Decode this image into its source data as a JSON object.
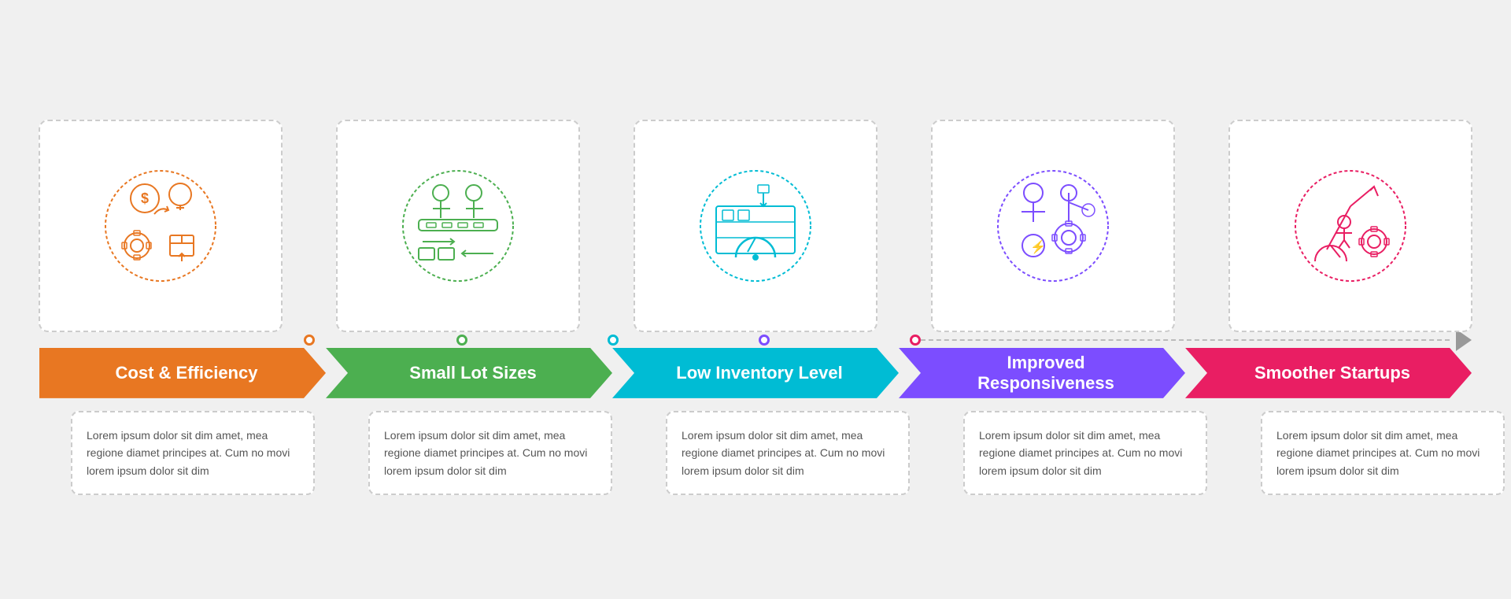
{
  "items": [
    {
      "id": "cost-efficiency",
      "title": "Cost & Efficiency",
      "color": "#e87722",
      "dot_color": "#e87722",
      "text": "Lorem ipsum dolor sit dim amet, mea regione diamet principes at. Cum no movi lorem ipsum dolor sit dim",
      "icon_type": "cost-efficiency"
    },
    {
      "id": "small-lot-sizes",
      "title": "Small Lot Sizes",
      "color": "#4caf50",
      "dot_color": "#4caf50",
      "text": "Lorem ipsum dolor sit dim amet, mea regione diamet principes at. Cum no movi lorem ipsum dolor sit dim",
      "icon_type": "small-lot-sizes"
    },
    {
      "id": "low-inventory",
      "title": "Low Inventory Level",
      "color": "#00bcd4",
      "dot_color": "#00bcd4",
      "text": "Lorem ipsum dolor sit dim amet, mea regione diamet principes at. Cum no movi lorem ipsum dolor sit dim",
      "icon_type": "low-inventory"
    },
    {
      "id": "improved-responsiveness",
      "title": "Improved Responsiveness",
      "color": "#7c4dff",
      "dot_color": "#7c4dff",
      "text": "Lorem ipsum dolor sit dim amet, mea regione diamet principes at. Cum no movi lorem ipsum dolor sit dim",
      "icon_type": "improved-responsiveness"
    },
    {
      "id": "smoother-startups",
      "title": "Smoother Startups",
      "color": "#e91e63",
      "dot_color": "#e91e63",
      "text": "Lorem ipsum dolor sit dim amet, mea regione diamet principes at. Cum no movi lorem ipsum dolor sit dim",
      "icon_type": "smoother-startups"
    }
  ],
  "end_arrow_color": "#9e9e9e"
}
